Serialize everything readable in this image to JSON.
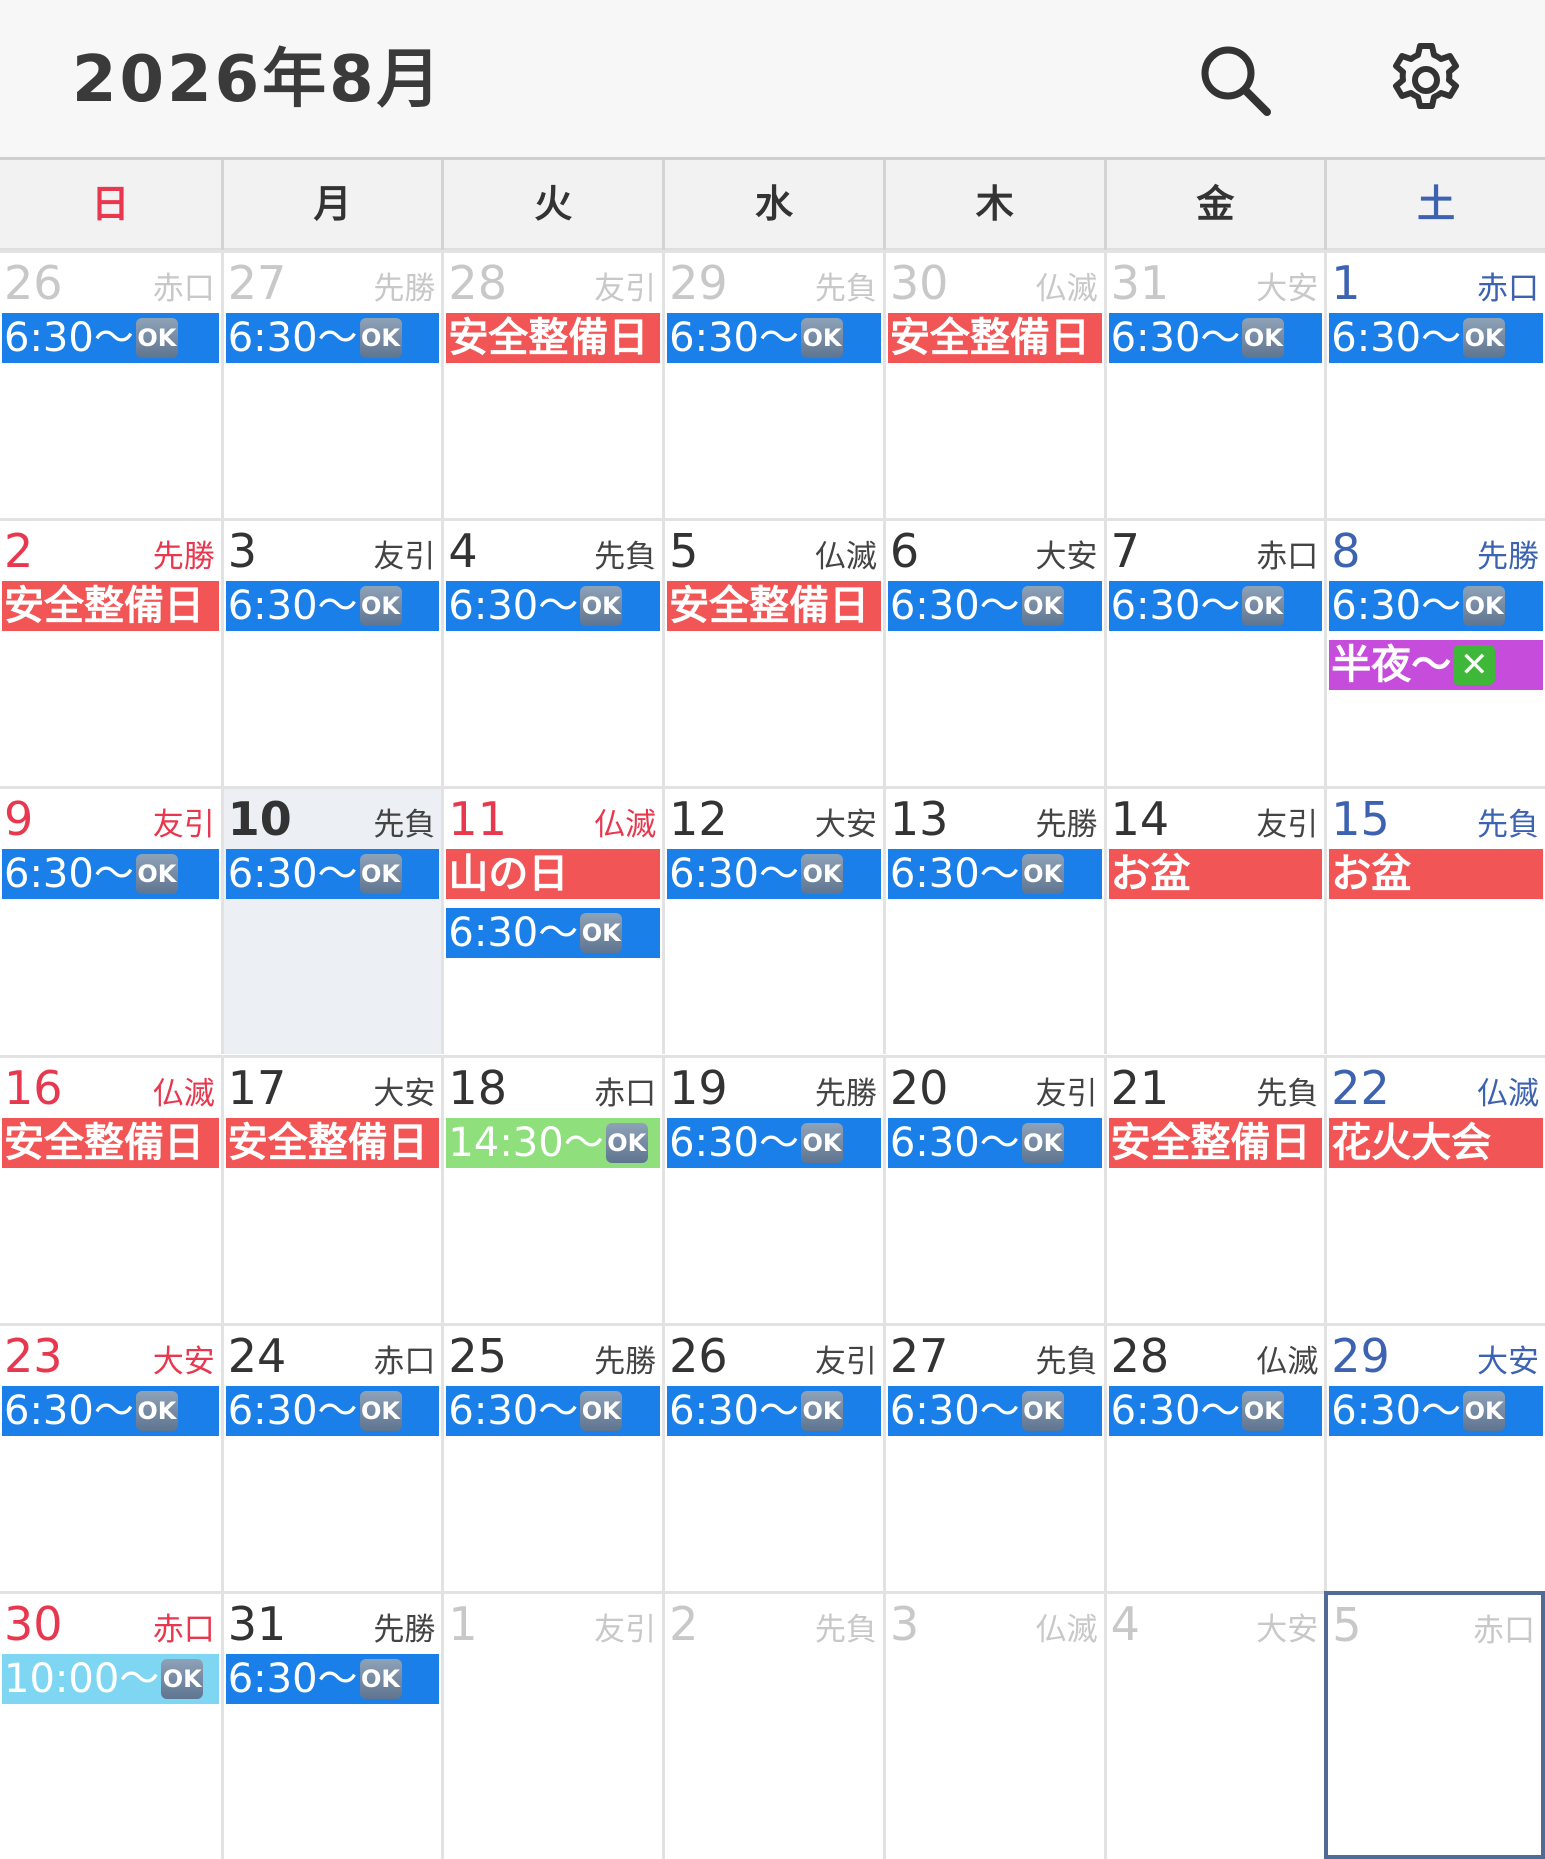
{
  "header": {
    "title": "2026年8月",
    "search_icon": "search-icon",
    "settings_icon": "gear-icon"
  },
  "colors": {
    "sunday": "#e8384f",
    "saturday": "#3d63b0",
    "holiday": "#e8384f",
    "event_blue": "#1a7fe8",
    "event_red": "#f25555",
    "event_green": "#8fe07d",
    "event_cyan": "#7fd6f2",
    "event_purple": "#c64cdb",
    "today_bg": "#ecf0f4",
    "selected_border": "#506c96"
  },
  "weekdays": [
    "日",
    "月",
    "火",
    "水",
    "木",
    "金",
    "土"
  ],
  "weeks": [
    [
      {
        "day": "26",
        "rokuyo": "赤口",
        "out": true,
        "events": [
          {
            "text": "6:30〜",
            "icon": "ok",
            "color": "blue"
          }
        ]
      },
      {
        "day": "27",
        "rokuyo": "先勝",
        "out": true,
        "events": [
          {
            "text": "6:30〜",
            "icon": "ok",
            "color": "blue"
          }
        ]
      },
      {
        "day": "28",
        "rokuyo": "友引",
        "out": true,
        "events": [
          {
            "text": "安全整備日",
            "color": "red"
          }
        ]
      },
      {
        "day": "29",
        "rokuyo": "先負",
        "out": true,
        "events": [
          {
            "text": "6:30〜",
            "icon": "ok",
            "color": "blue"
          }
        ]
      },
      {
        "day": "30",
        "rokuyo": "仏滅",
        "out": true,
        "events": [
          {
            "text": "安全整備日",
            "color": "red"
          }
        ]
      },
      {
        "day": "31",
        "rokuyo": "大安",
        "out": true,
        "events": [
          {
            "text": "6:30〜",
            "icon": "ok",
            "color": "blue"
          }
        ]
      },
      {
        "day": "1",
        "rokuyo": "赤口",
        "events": [
          {
            "text": "6:30〜",
            "icon": "ok",
            "color": "blue"
          }
        ]
      }
    ],
    [
      {
        "day": "2",
        "rokuyo": "先勝",
        "events": [
          {
            "text": "安全整備日",
            "color": "red"
          }
        ]
      },
      {
        "day": "3",
        "rokuyo": "友引",
        "events": [
          {
            "text": "6:30〜",
            "icon": "ok",
            "color": "blue"
          }
        ]
      },
      {
        "day": "4",
        "rokuyo": "先負",
        "events": [
          {
            "text": "6:30〜",
            "icon": "ok",
            "color": "blue"
          }
        ]
      },
      {
        "day": "5",
        "rokuyo": "仏滅",
        "events": [
          {
            "text": "安全整備日",
            "color": "red"
          }
        ]
      },
      {
        "day": "6",
        "rokuyo": "大安",
        "events": [
          {
            "text": "6:30〜",
            "icon": "ok",
            "color": "blue"
          }
        ]
      },
      {
        "day": "7",
        "rokuyo": "赤口",
        "events": [
          {
            "text": "6:30〜",
            "icon": "ok",
            "color": "blue"
          }
        ]
      },
      {
        "day": "8",
        "rokuyo": "先勝",
        "events": [
          {
            "text": "6:30〜",
            "icon": "ok",
            "color": "blue"
          },
          {
            "text": "半夜〜",
            "icon": "x",
            "color": "purple"
          }
        ]
      }
    ],
    [
      {
        "day": "9",
        "rokuyo": "友引",
        "events": [
          {
            "text": "6:30〜",
            "icon": "ok",
            "color": "blue"
          }
        ]
      },
      {
        "day": "10",
        "rokuyo": "先負",
        "today": true,
        "events": [
          {
            "text": "6:30〜",
            "icon": "ok",
            "color": "blue"
          }
        ]
      },
      {
        "day": "11",
        "rokuyo": "仏滅",
        "holiday": true,
        "events": [
          {
            "text": "山の日",
            "color": "red"
          },
          {
            "text": "6:30〜",
            "icon": "ok",
            "color": "blue"
          }
        ]
      },
      {
        "day": "12",
        "rokuyo": "大安",
        "events": [
          {
            "text": "6:30〜",
            "icon": "ok",
            "color": "blue"
          }
        ]
      },
      {
        "day": "13",
        "rokuyo": "先勝",
        "events": [
          {
            "text": "6:30〜",
            "icon": "ok",
            "color": "blue"
          }
        ]
      },
      {
        "day": "14",
        "rokuyo": "友引",
        "events": [
          {
            "text": "お盆",
            "color": "red"
          }
        ]
      },
      {
        "day": "15",
        "rokuyo": "先負",
        "events": [
          {
            "text": "お盆",
            "color": "red"
          }
        ]
      }
    ],
    [
      {
        "day": "16",
        "rokuyo": "仏滅",
        "events": [
          {
            "text": "安全整備日",
            "color": "red"
          }
        ]
      },
      {
        "day": "17",
        "rokuyo": "大安",
        "events": [
          {
            "text": "安全整備日",
            "color": "red"
          }
        ]
      },
      {
        "day": "18",
        "rokuyo": "赤口",
        "events": [
          {
            "text": "14:30〜",
            "icon": "ok",
            "color": "green"
          }
        ]
      },
      {
        "day": "19",
        "rokuyo": "先勝",
        "events": [
          {
            "text": "6:30〜",
            "icon": "ok",
            "color": "blue"
          }
        ]
      },
      {
        "day": "20",
        "rokuyo": "友引",
        "events": [
          {
            "text": "6:30〜",
            "icon": "ok",
            "color": "blue"
          }
        ]
      },
      {
        "day": "21",
        "rokuyo": "先負",
        "events": [
          {
            "text": "安全整備日",
            "color": "red"
          }
        ]
      },
      {
        "day": "22",
        "rokuyo": "仏滅",
        "events": [
          {
            "text": "花火大会",
            "color": "red"
          }
        ]
      }
    ],
    [
      {
        "day": "23",
        "rokuyo": "大安",
        "events": [
          {
            "text": "6:30〜",
            "icon": "ok",
            "color": "blue"
          }
        ]
      },
      {
        "day": "24",
        "rokuyo": "赤口",
        "events": [
          {
            "text": "6:30〜",
            "icon": "ok",
            "color": "blue"
          }
        ]
      },
      {
        "day": "25",
        "rokuyo": "先勝",
        "events": [
          {
            "text": "6:30〜",
            "icon": "ok",
            "color": "blue"
          }
        ]
      },
      {
        "day": "26",
        "rokuyo": "友引",
        "events": [
          {
            "text": "6:30〜",
            "icon": "ok",
            "color": "blue"
          }
        ]
      },
      {
        "day": "27",
        "rokuyo": "先負",
        "events": [
          {
            "text": "6:30〜",
            "icon": "ok",
            "color": "blue"
          }
        ]
      },
      {
        "day": "28",
        "rokuyo": "仏滅",
        "events": [
          {
            "text": "6:30〜",
            "icon": "ok",
            "color": "blue"
          }
        ]
      },
      {
        "day": "29",
        "rokuyo": "大安",
        "events": [
          {
            "text": "6:30〜",
            "icon": "ok",
            "color": "blue"
          }
        ]
      }
    ],
    [
      {
        "day": "30",
        "rokuyo": "赤口",
        "events": [
          {
            "text": "10:00〜",
            "icon": "ok",
            "color": "cyan"
          }
        ]
      },
      {
        "day": "31",
        "rokuyo": "先勝",
        "events": [
          {
            "text": "6:30〜",
            "icon": "ok",
            "color": "blue"
          }
        ]
      },
      {
        "day": "1",
        "rokuyo": "友引",
        "out": true,
        "events": []
      },
      {
        "day": "2",
        "rokuyo": "先負",
        "out": true,
        "events": []
      },
      {
        "day": "3",
        "rokuyo": "仏滅",
        "out": true,
        "events": []
      },
      {
        "day": "4",
        "rokuyo": "大安",
        "out": true,
        "events": []
      },
      {
        "day": "5",
        "rokuyo": "赤口",
        "out": true,
        "selected": true,
        "events": []
      }
    ]
  ],
  "ok_label": "OK",
  "x_label": "✕"
}
